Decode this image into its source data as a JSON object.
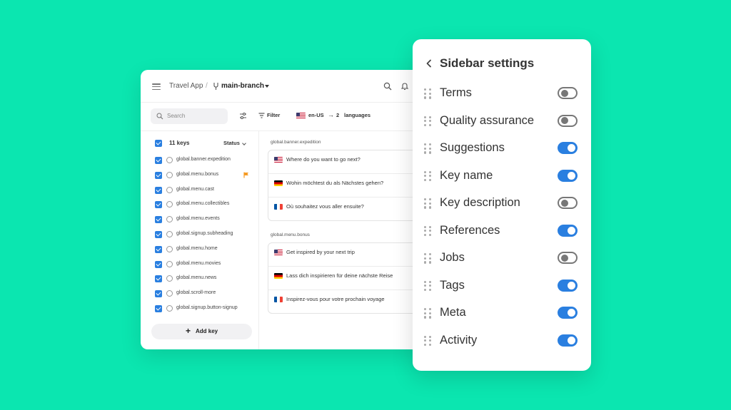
{
  "colors": {
    "background": "#0be6b0",
    "accent": "#2a7fe0",
    "flag_marker": "#f59a23"
  },
  "app": {
    "header": {
      "app_name": "Travel App",
      "separator": "/",
      "branch": "main-branch"
    },
    "toolbar": {
      "search_placeholder": "Search",
      "filter_label": "Filter",
      "source_lang": "en-US",
      "arrow": "→",
      "target_count": "2",
      "target_label": "languages"
    },
    "keys_panel": {
      "count_label": "11 keys",
      "status_label": "Status",
      "keys": [
        {
          "name": "global.banner.expedition",
          "flagged": false
        },
        {
          "name": "global.menu.bonus",
          "flagged": true
        },
        {
          "name": "global.menu.cast",
          "flagged": false
        },
        {
          "name": "global.menu.collectibles",
          "flagged": false
        },
        {
          "name": "global.menu.events",
          "flagged": false
        },
        {
          "name": "global.signup.subheading",
          "flagged": false
        },
        {
          "name": "global.menu.home",
          "flagged": false
        },
        {
          "name": "global.menu.movies",
          "flagged": false
        },
        {
          "name": "global.menu.news",
          "flagged": false
        },
        {
          "name": "global.scroll-more",
          "flagged": false
        },
        {
          "name": "global.signup.button-signup",
          "flagged": false
        }
      ],
      "add_key_label": "Add key"
    },
    "translations": [
      {
        "key": "global.banner.expedition",
        "rows": [
          {
            "lang": "us",
            "text": "Where do you want to go next?"
          },
          {
            "lang": "de",
            "text": "Wohin möchtest du als Nächstes gehen?"
          },
          {
            "lang": "fr",
            "text": "Où souhaitez vous aller ensuite?"
          }
        ]
      },
      {
        "key": "global.menu.bonus",
        "rows": [
          {
            "lang": "us",
            "text": "Get inspired by your next trip"
          },
          {
            "lang": "de",
            "text": "Lass dich inspirieren für deine nächste Reise"
          },
          {
            "lang": "fr",
            "text": "Inspirez-vous pour votre prochain voyage"
          }
        ]
      }
    ]
  },
  "settings": {
    "title": "Sidebar settings",
    "items": [
      {
        "label": "Terms",
        "enabled": false
      },
      {
        "label": "Quality assurance",
        "enabled": false
      },
      {
        "label": "Suggestions",
        "enabled": true
      },
      {
        "label": "Key name",
        "enabled": true
      },
      {
        "label": "Key description",
        "enabled": false
      },
      {
        "label": "References",
        "enabled": true
      },
      {
        "label": "Jobs",
        "enabled": false
      },
      {
        "label": "Tags",
        "enabled": true
      },
      {
        "label": "Meta",
        "enabled": true
      },
      {
        "label": "Activity",
        "enabled": true
      }
    ]
  }
}
